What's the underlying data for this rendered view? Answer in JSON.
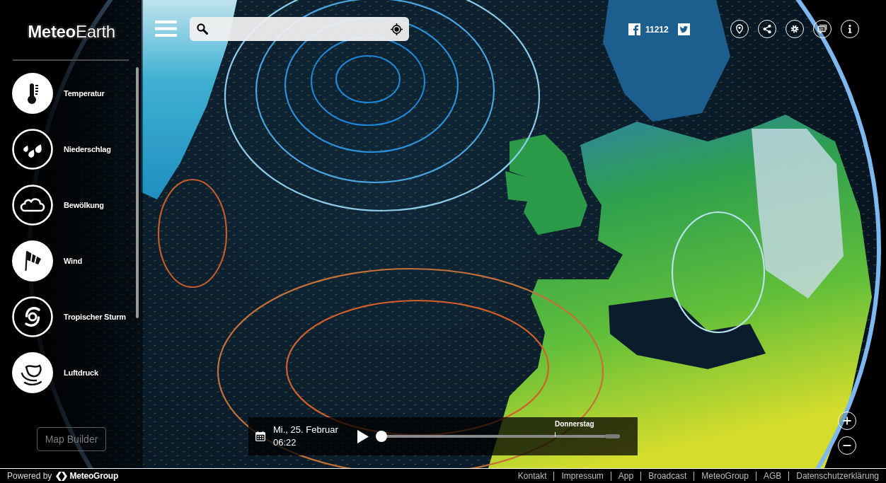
{
  "sidebar": {
    "logo": "**Meteo**Earth",
    "layers": [
      {
        "label": "Temperatur",
        "selected": true
      },
      {
        "label": "Niederschlag",
        "selected": false
      },
      {
        "label": "Bewölkung",
        "selected": false
      },
      {
        "label": "Wind",
        "selected": true
      },
      {
        "label": "Tropischer Sturm",
        "selected": false
      },
      {
        "label": "Luftdruck",
        "selected": true
      }
    ],
    "map_builder": {
      "label": "Map Builder",
      "disabled": true
    }
  },
  "social": {
    "likes": "11212"
  },
  "timeline": {
    "date": "Mi., 25. Februar",
    "time": "06:22",
    "level": 0,
    "day_marker": "Donnerstag"
  },
  "footer": {
    "powered_by": "Powered by",
    "brand": "MeteoGroup",
    "links": [
      "Kontakt",
      "Impressum",
      "App",
      "Broadcast",
      "MeteoGroup",
      "AGB",
      "Datenschutzerklärung"
    ]
  }
}
